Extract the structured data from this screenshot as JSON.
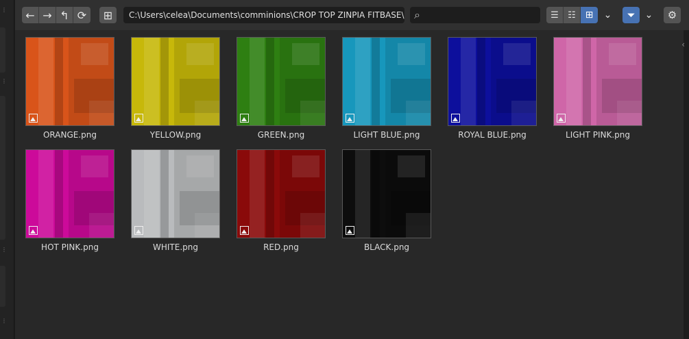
{
  "header": {
    "nav": {
      "back_icon": "←",
      "forward_icon": "→",
      "parent_icon": "↰",
      "refresh_icon": "⟳"
    },
    "new_folder_icon": "⊞",
    "path": "C:\\Users\\celea\\Documents\\comminions\\CROP TOP ZINPIA FITBASE\\COLL...",
    "search": {
      "icon": "⌕",
      "value": "",
      "placeholder": ""
    },
    "display_modes": {
      "vertical_list_icon": "☰",
      "horizontal_list_icon": "☷",
      "thumbnails_icon": "⊞",
      "selected": "thumbnails"
    },
    "display_dropdown_icon": "⌄",
    "filter_icon": "⏷",
    "filter_dropdown_icon": "⌄",
    "settings_icon": "⚙",
    "accent_color": "#4772b3"
  },
  "files": [
    {
      "name": "ORANGE.png",
      "color": "#d9541a"
    },
    {
      "name": "YELLOW.png",
      "color": "#c7b80a"
    },
    {
      "name": "GREEN.png",
      "color": "#2e7f12"
    },
    {
      "name": "LIGHT BLUE.png",
      "color": "#1797bc"
    },
    {
      "name": "ROYAL BLUE.png",
      "color": "#0d0f9c"
    },
    {
      "name": "LIGHT PINK.png",
      "color": "#cf66a8"
    },
    {
      "name": "HOT PINK.png",
      "color": "#cc0a9a"
    },
    {
      "name": "WHITE.png",
      "color": "#b9bbbd"
    },
    {
      "name": "RED.png",
      "color": "#8a0a0a"
    },
    {
      "name": "BLACK.png",
      "color": "#0d0d0d"
    }
  ]
}
